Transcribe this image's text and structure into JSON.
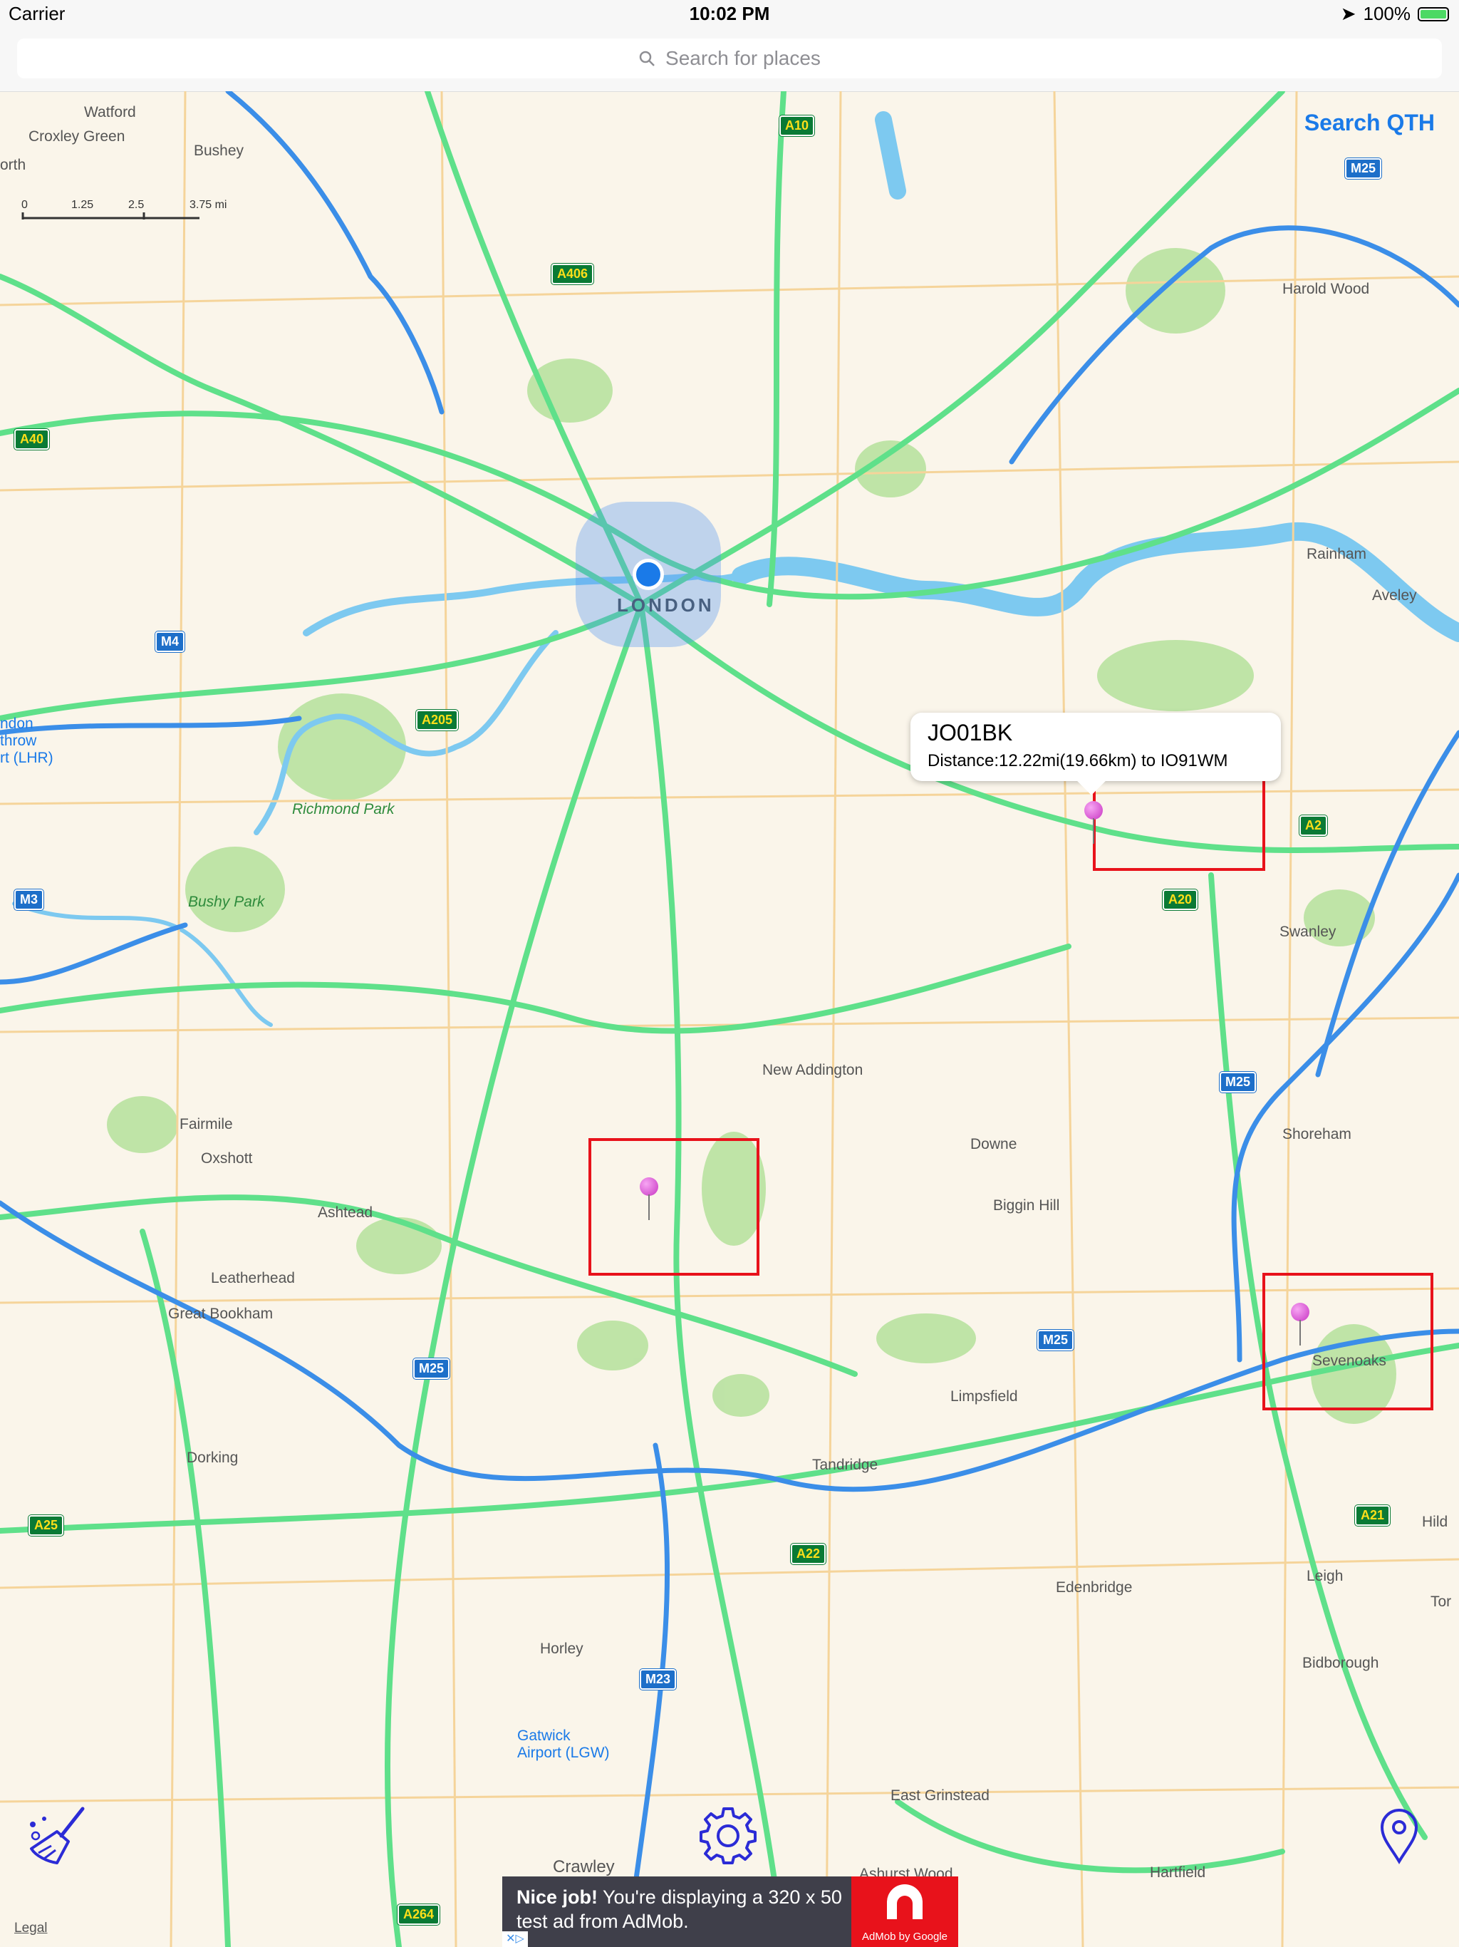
{
  "status_bar": {
    "carrier": "Carrier",
    "time": "10:02 PM",
    "battery": "100%"
  },
  "search": {
    "placeholder": "Search for places"
  },
  "map": {
    "search_qth_label": "Search QTH",
    "legal_label": "Legal",
    "scale": {
      "ticks": [
        "0",
        "1.25",
        "2.5",
        "3.75 mi"
      ]
    },
    "places": {
      "watford": "Watford",
      "croxley_green": "Croxley Green",
      "bushey": "Bushey",
      "north": "orth",
      "harold_wood": "Harold Wood",
      "rainham": "Rainham",
      "aveley": "Aveley",
      "london": "LONDON",
      "heathrow": "ndon\nthrow\nrt (LHR)",
      "richmond_park": "Richmond Park",
      "bushy_park": "Bushy Park",
      "swanley": "Swanley",
      "new_addington": "New Addington",
      "downe": "Downe",
      "biggin_hill": "Biggin Hill",
      "shoreham": "Shoreham",
      "fairmile": "Fairmile",
      "oxshott": "Oxshott",
      "ashtead": "Ashtead",
      "leatherhead": "Leatherhead",
      "great_bookham": "Great Bookham",
      "sevenoaks": "Sevenoaks",
      "limpsfield": "Limpsfield",
      "tandridge": "Tandridge",
      "dorking": "Dorking",
      "edenbridge": "Edenbridge",
      "leigh": "Leigh",
      "bidborough": "Bidborough",
      "hild": "Hild",
      "tor": "Tor",
      "horley": "Horley",
      "gatwick": "Gatwick\nAirport (LGW)",
      "east_grinstead": "East Grinstead",
      "hartfield": "Hartfield",
      "crawley": "Crawley",
      "ashurst_wood": "Ashurst Wood"
    },
    "roads": [
      "A10",
      "M25",
      "A406",
      "A40",
      "M4",
      "A205",
      "A2",
      "A20",
      "M3",
      "M25",
      "M25",
      "M25",
      "A25",
      "A22",
      "A21",
      "M23",
      "A264"
    ],
    "callout": {
      "title": "JO01BK",
      "subtitle": "Distance:12.22mi(19.66km) to IO91WM"
    }
  },
  "toolbar": {
    "clear_icon": "broom-icon",
    "settings_icon": "gear-icon",
    "locate_icon": "location-pin-icon"
  },
  "ad": {
    "headline": "Nice job!",
    "body": " You're displaying a 320 x 50 test ad from AdMob.",
    "brand": "AdMob by Google"
  },
  "colors": {
    "accent": "#1a7ae8",
    "highlight_box": "#e8121b",
    "pin": "#d14bd0",
    "road_major": "#5fe08a",
    "motorway": "#3b8ee8"
  }
}
